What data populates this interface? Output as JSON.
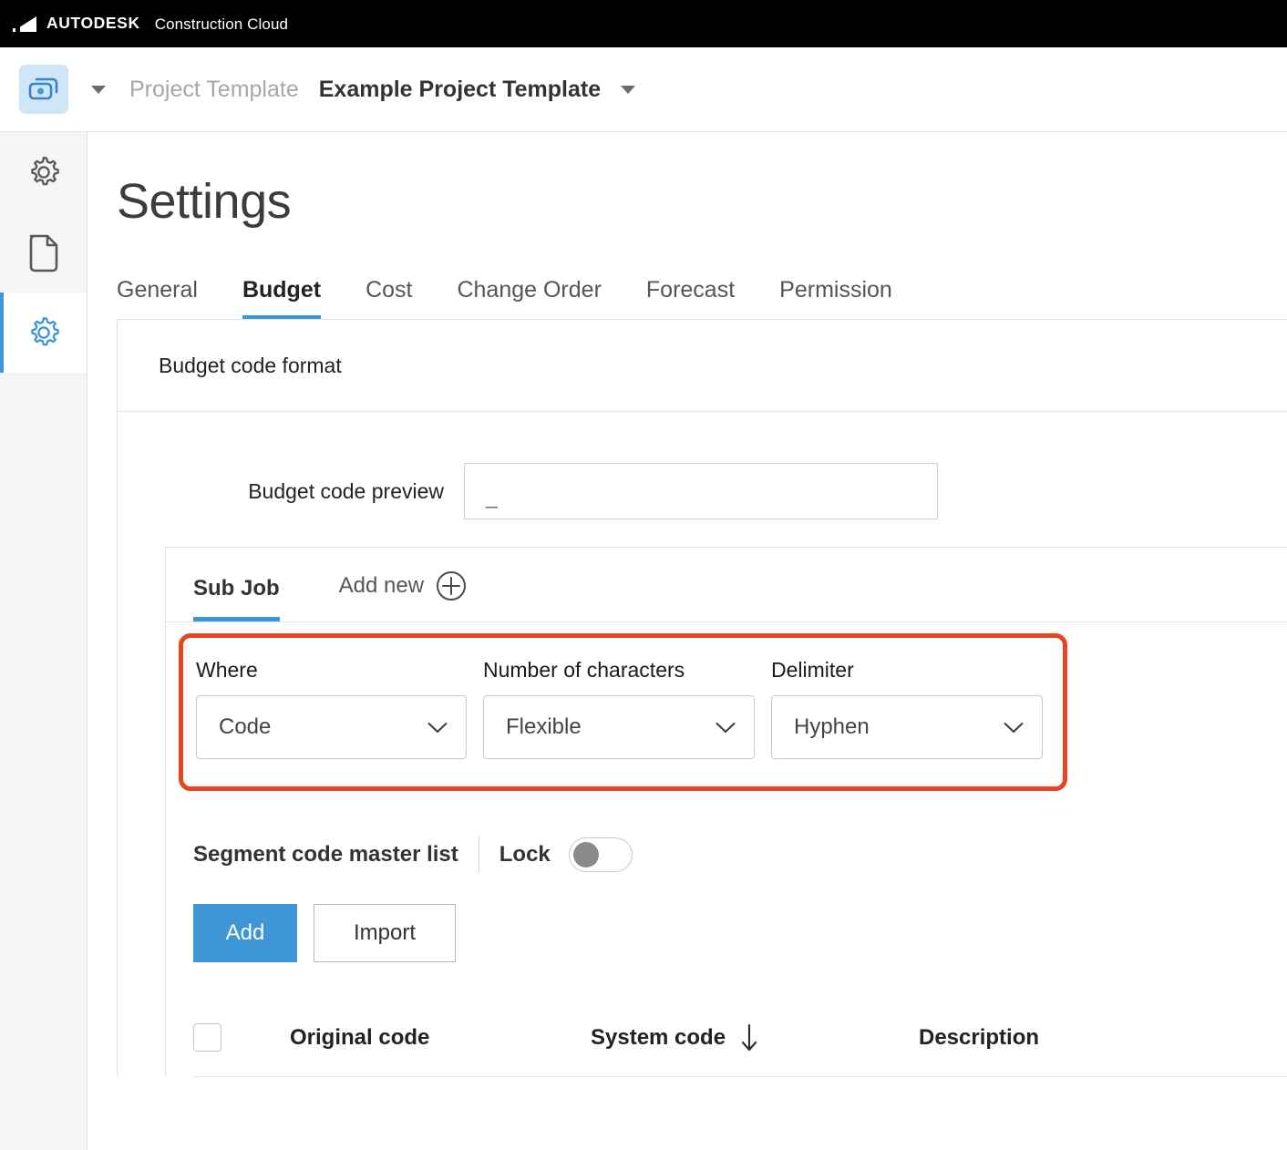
{
  "topbar": {
    "brand": "AUTODESK",
    "product": "Construction Cloud",
    "logo_icon": "autodesk-logo-icon"
  },
  "header": {
    "project_icon": "cost-management-icon",
    "project_menu_caret": "caret-down-icon",
    "breadcrumb_parent": "Project Template",
    "breadcrumb_current": "Example Project Template",
    "breadcrumb_caret": "caret-down-icon"
  },
  "rail": {
    "items": [
      {
        "name": "gear-icon",
        "label": "Settings",
        "active": false
      },
      {
        "name": "document-icon",
        "label": "Documents",
        "active": false
      },
      {
        "name": "gear-icon",
        "label": "Project Settings",
        "active": true
      }
    ]
  },
  "page": {
    "title": "Settings"
  },
  "tabs": [
    {
      "label": "General",
      "active": false
    },
    {
      "label": "Budget",
      "active": true
    },
    {
      "label": "Cost",
      "active": false
    },
    {
      "label": "Change Order",
      "active": false
    },
    {
      "label": "Forecast",
      "active": false
    },
    {
      "label": "Permission",
      "active": false
    }
  ],
  "panel": {
    "header_title": "Budget code format",
    "preview": {
      "label": "Budget code preview",
      "value": "_",
      "placeholder": ""
    },
    "subtabs": {
      "sub_job": "Sub Job",
      "add_new": "Add new",
      "add_new_icon": "plus-circle-icon"
    },
    "highlight_color": "#e8441f",
    "fields": [
      {
        "label": "Where",
        "value": "Code",
        "icon": "chevron-down-icon"
      },
      {
        "label": "Number of characters",
        "value": "Flexible",
        "icon": "chevron-down-icon"
      },
      {
        "label": "Delimiter",
        "value": "Hyphen",
        "icon": "chevron-down-icon"
      }
    ],
    "segment": {
      "title": "Segment code master list",
      "lock_label": "Lock",
      "lock_on": false
    },
    "buttons": {
      "add": "Add",
      "import": "Import"
    },
    "table": {
      "columns": [
        {
          "key": "select",
          "label": ""
        },
        {
          "key": "original",
          "label": "Original code"
        },
        {
          "key": "system",
          "label": "System code",
          "sort_icon": "arrow-down-icon"
        },
        {
          "key": "description",
          "label": "Description"
        }
      ],
      "rows": []
    }
  },
  "colors": {
    "accent_blue": "#3f96d6",
    "highlight_red": "#e8441f",
    "topbar_black": "#000000",
    "rail_bg": "#f5f5f5"
  }
}
